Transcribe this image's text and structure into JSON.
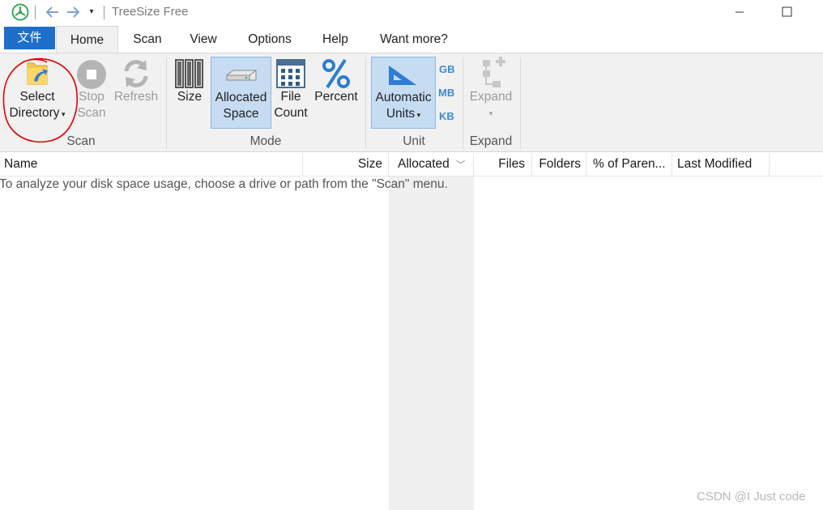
{
  "window": {
    "title": "TreeSize Free"
  },
  "quick_access": {
    "dropdown_glyph": "▾"
  },
  "menu_tabs": [
    {
      "label": "文件"
    },
    {
      "label": "Home"
    },
    {
      "label": "Scan"
    },
    {
      "label": "View"
    },
    {
      "label": "Options"
    },
    {
      "label": "Help"
    },
    {
      "label": "Want more?"
    }
  ],
  "ribbon": {
    "scan_group": {
      "label": "Scan",
      "select_directory": {
        "line1": "Select",
        "line2": "Directory"
      },
      "stop_scan": {
        "line1": "Stop",
        "line2": "Scan"
      },
      "refresh": {
        "line1": "Refresh"
      }
    },
    "mode_group": {
      "label": "Mode",
      "size": {
        "line1": "Size"
      },
      "allocated_space": {
        "line1": "Allocated",
        "line2": "Space"
      },
      "file_count": {
        "line1": "File",
        "line2": "Count"
      },
      "percent": {
        "line1": "Percent"
      }
    },
    "unit_group": {
      "label": "Unit",
      "automatic_units": {
        "line1": "Automatic",
        "line2": "Units"
      },
      "gb": "GB",
      "mb": "MB",
      "kb": "KB"
    },
    "expand_group": {
      "label": "Expand",
      "expand": {
        "line1": "Expand"
      }
    }
  },
  "columns": {
    "name": "Name",
    "size": "Size",
    "allocated": "Allocated",
    "files": "Files",
    "folders": "Folders",
    "percent_parent": "% of Paren...",
    "last_modified": "Last Modified"
  },
  "empty_message": "To analyze your disk space usage, choose a drive or path from the \"Scan\" menu.",
  "watermark": "CSDN @I Just code",
  "colors": {
    "file_tab": "#1d6fc9",
    "active_button": "#c5dcf3",
    "annotation_circle": "#e00000"
  }
}
